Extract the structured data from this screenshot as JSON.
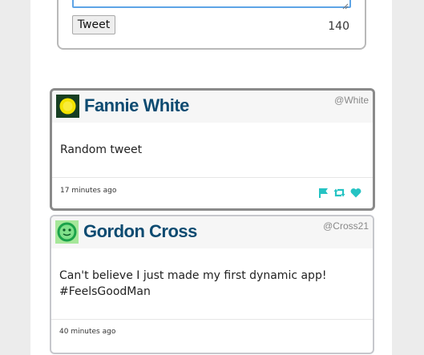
{
  "composer": {
    "button_label": "Tweet",
    "char_count": "140"
  },
  "tweets": [
    {
      "name": "Fannie White",
      "handle": "@White",
      "text": "Random tweet",
      "time": "17 minutes ago",
      "avatar_icon": "sun-icon"
    },
    {
      "name": "Gordon Cross",
      "handle": "@Cross21",
      "text": "Can't believe I just made my first dynamic app!\n#FeelsGoodMan",
      "time": "40 minutes ago",
      "avatar_icon": "pickle-face-icon"
    }
  ],
  "colors": {
    "name": "#0d4b71",
    "action_icons": "#25c3c3",
    "textarea_focus": "#5ea4e6"
  }
}
